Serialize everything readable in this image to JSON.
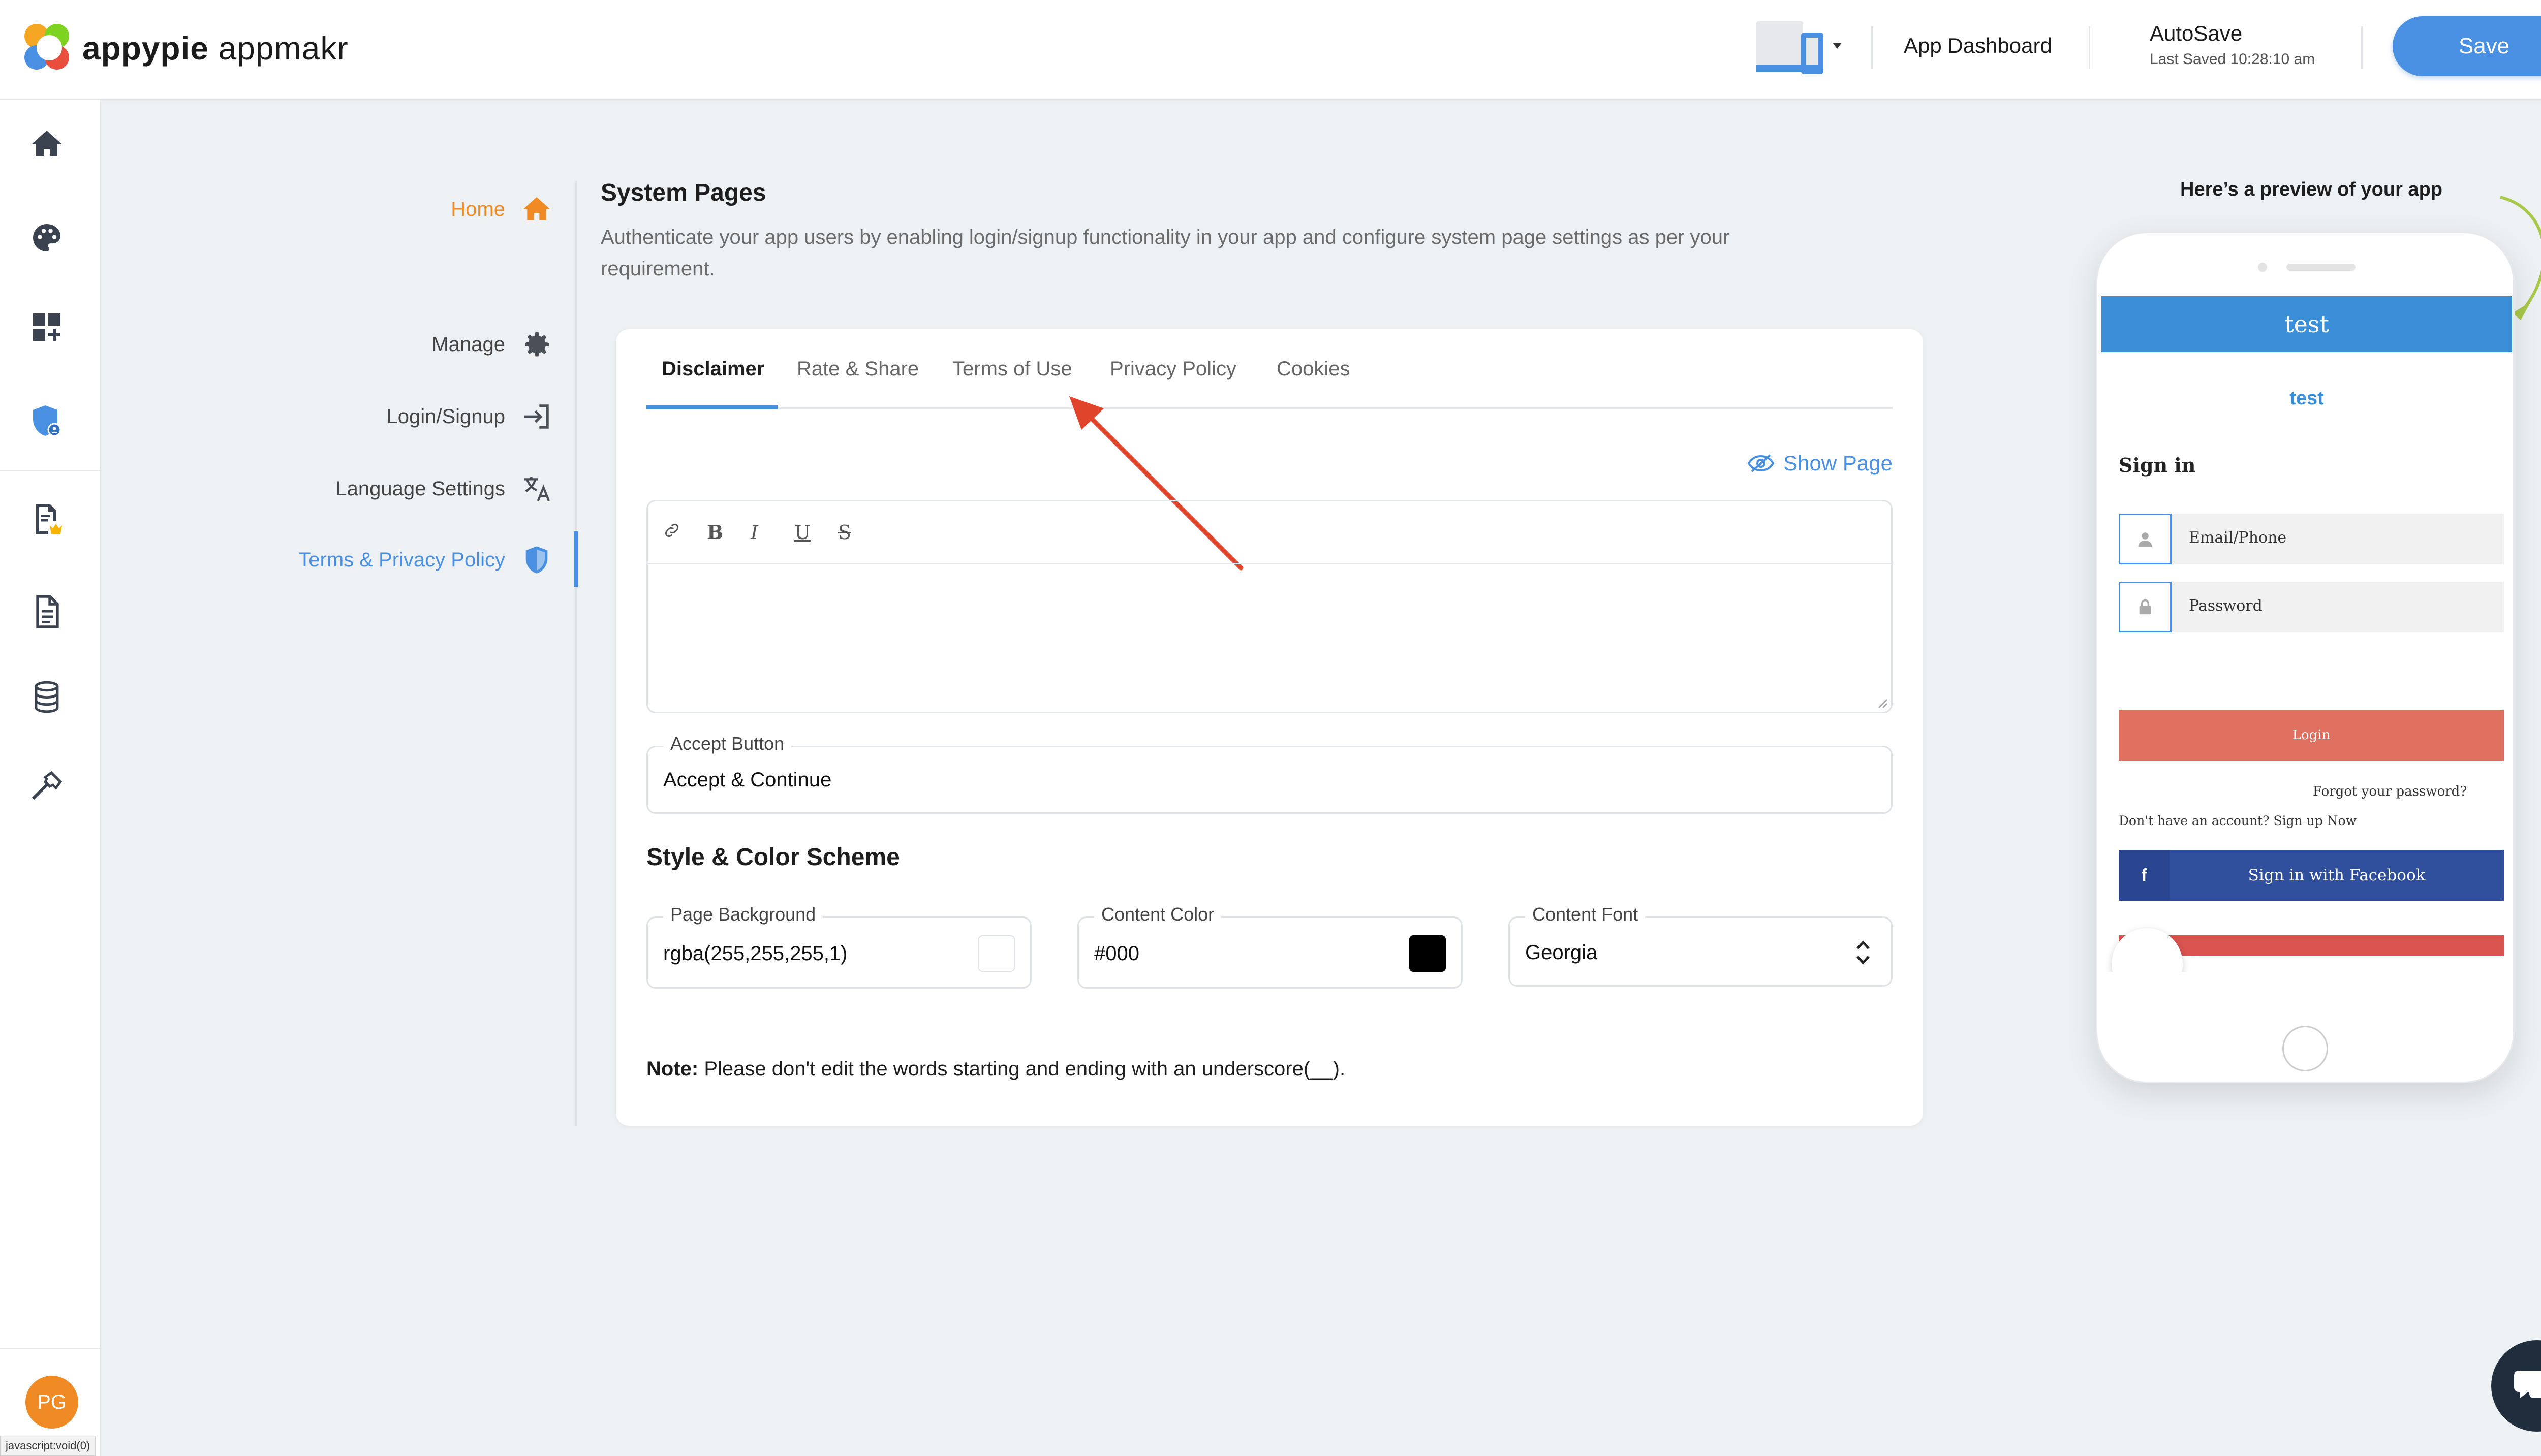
{
  "header": {
    "logo_bold": "appypie",
    "logo_light": "appmakr",
    "app_dashboard": "App Dashboard",
    "autosave": "AutoSave",
    "last_saved": "Last Saved 10:28:10 am",
    "save_label": "Save"
  },
  "rail": {
    "items": [
      "home-icon",
      "palette-icon",
      "add-grid-icon",
      "shield-user-icon",
      "doc-crown-icon",
      "document-icon",
      "database-icon",
      "hammer-icon"
    ],
    "avatar_initials": "PG",
    "status_url": "javascript:void(0)"
  },
  "menu": {
    "home": "Home",
    "manage": "Manage",
    "login_signup": "Login/Signup",
    "language_settings": "Language Settings",
    "terms_privacy": "Terms & Privacy Policy"
  },
  "main": {
    "title": "System Pages",
    "description": "Authenticate your app users by enabling login/signup functionality in your app and configure system page settings as per your requirement.",
    "tabs": [
      {
        "label": "Disclaimer",
        "active": true
      },
      {
        "label": "Rate & Share",
        "active": false
      },
      {
        "label": "Terms of Use",
        "active": false
      },
      {
        "label": "Privacy Policy",
        "active": false
      },
      {
        "label": "Cookies",
        "active": false
      }
    ],
    "show_page": "Show Page",
    "toolbar": {
      "link": "link-icon",
      "bold": "B",
      "italic": "I",
      "underline": "U",
      "strike": "S"
    },
    "accept_button": {
      "label": "Accept Button",
      "value": "Accept & Continue"
    },
    "style_title": "Style & Color Scheme",
    "page_background": {
      "label": "Page Background",
      "value": "rgba(255,255,255,1)",
      "swatch": "#ffffff"
    },
    "content_color": {
      "label": "Content Color",
      "value": "#000",
      "swatch": "#000000"
    },
    "content_font": {
      "label": "Content Font",
      "value": "Georgia"
    },
    "note_bold": "Note:",
    "note_text": " Please don't edit the words starting and ending with an underscore(__)."
  },
  "preview": {
    "label": "Here’s a preview of your app",
    "header_title": "test",
    "logo_text": "test",
    "sign_in": "Sign in",
    "email_placeholder": "Email/Phone",
    "password_placeholder": "Password",
    "login": "Login",
    "forgot": "Forgot your password?",
    "no_account": "Don't have an account? Sign up Now",
    "facebook": "Sign in with Facebook",
    "facebook_icon": "f"
  },
  "colors": {
    "accent": "#4a90e2",
    "home_orange": "#f08a24",
    "annotation_red": "#e0452b",
    "phone_header": "#3b8fd9",
    "login_button": "#e07060",
    "facebook": "#2f4e9c"
  }
}
